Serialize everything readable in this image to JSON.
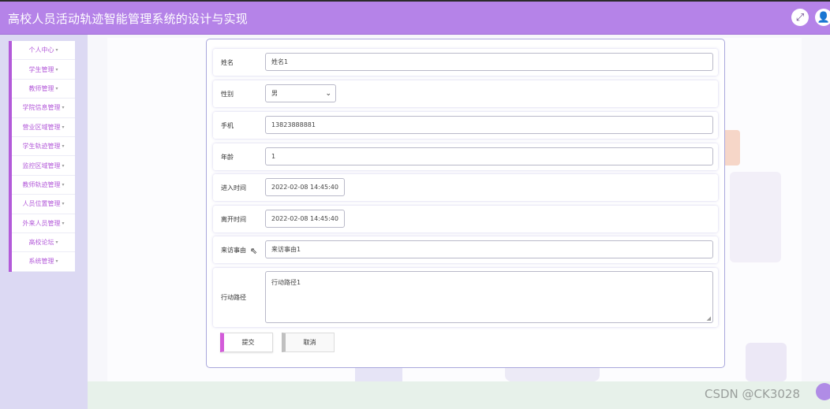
{
  "app": {
    "title": "高校人员活动轨迹智能管理系统的设计与实现",
    "fullscreen_icon": "⤢",
    "user_icon": "👤"
  },
  "sidebar": {
    "items": [
      {
        "label": "个人中心"
      },
      {
        "label": "学生管理"
      },
      {
        "label": "教师管理"
      },
      {
        "label": "学院信息管理"
      },
      {
        "label": "营业区域管理"
      },
      {
        "label": "学生轨迹管理"
      },
      {
        "label": "监控区域管理"
      },
      {
        "label": "教师轨迹管理"
      },
      {
        "label": "人员位置管理"
      },
      {
        "label": "外来人员管理"
      },
      {
        "label": "高校论坛"
      },
      {
        "label": "系统管理"
      }
    ],
    "caret": "▾"
  },
  "form": {
    "name_label": "姓名",
    "name_value": "姓名1",
    "gender_label": "性别",
    "gender_value": "男",
    "gender_chevron": "⌄",
    "phone_label": "手机",
    "phone_value": "13823888881",
    "age_label": "年龄",
    "age_value": "1",
    "enter_label": "进入时间",
    "enter_value": "2022-02-08 14:45:40",
    "leave_label": "离开时间",
    "leave_value": "2022-02-08 14:45:40",
    "reason_label": "来访事由",
    "reason_value": "来访事由1",
    "route_label": "行动路径",
    "route_value": "行动路径1",
    "grip": "◢"
  },
  "buttons": {
    "submit": "提交",
    "cancel": "取消"
  },
  "watermark": "CSDN @CK3028"
}
